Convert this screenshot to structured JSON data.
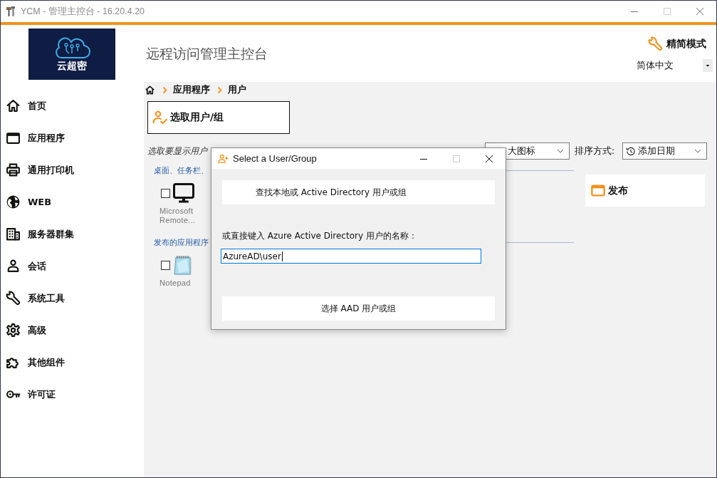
{
  "window": {
    "title": "YCM - 管理主控台 - 16.20.4.20"
  },
  "header": {
    "logo_text": "云超密",
    "title": "远程访问管理主控台",
    "mode_button": "精简模式",
    "language": {
      "value": "简体中文"
    }
  },
  "sidebar": {
    "items": [
      {
        "label": "首页",
        "selected": false
      },
      {
        "label": "应用程序",
        "selected": false
      },
      {
        "label": "通用打印机",
        "selected": false
      },
      {
        "label": "WEB",
        "selected": false
      },
      {
        "label": "服务器群集",
        "selected": false
      },
      {
        "label": "会话",
        "selected": false
      },
      {
        "label": "系统工具",
        "selected": false
      },
      {
        "label": "高级",
        "selected": false
      },
      {
        "label": "其他组件",
        "selected": false
      },
      {
        "label": "许可证",
        "selected": false
      }
    ]
  },
  "breadcrumb": [
    "应用程序",
    "用户"
  ],
  "select_button": "选取用户/组",
  "toolbar": {
    "hint": "选取要显示用户",
    "view_mode": {
      "value": "大图标"
    },
    "sort_label": "排序方式:",
    "sort": {
      "value": "添加日期"
    }
  },
  "groups": [
    {
      "title": "桌面、任务栏、",
      "apps": [
        {
          "name": "Microsoft Remote...",
          "checked": false
        }
      ]
    },
    {
      "title": "发布的应用程序",
      "apps": [
        {
          "name": "Notepad",
          "checked": false
        }
      ]
    }
  ],
  "publish_panel": {
    "label": "发布"
  },
  "dialog": {
    "title": "Select a User/Group",
    "find_button": "查找本地或 Active Directory 用户或组",
    "prompt": "或直接键入 Azure Active Directory 用户的名称：",
    "name_field": {
      "value": "AzureAD\\user",
      "focused": true
    },
    "aad_button": "选择 AAD 用户或组"
  }
}
